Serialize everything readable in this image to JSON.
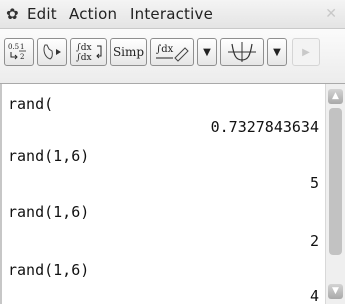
{
  "menubar": {
    "items": [
      "Edit",
      "Action",
      "Interactive"
    ]
  },
  "toolbar": {
    "buttons": [
      "fraction-decimal",
      "pen-play",
      "integral-toggle",
      "Simp",
      "integral-draw",
      "dropdown",
      "graph",
      "dropdown",
      "forward"
    ],
    "simp_label": "Simp"
  },
  "main": {
    "entries": [
      {
        "expr": "rand(",
        "result": "0.7327843634"
      },
      {
        "expr": "rand(1,6)",
        "result": "5"
      },
      {
        "expr": "rand(1,6)",
        "result": "2"
      },
      {
        "expr": "rand(1,6)",
        "result": "4"
      }
    ]
  }
}
